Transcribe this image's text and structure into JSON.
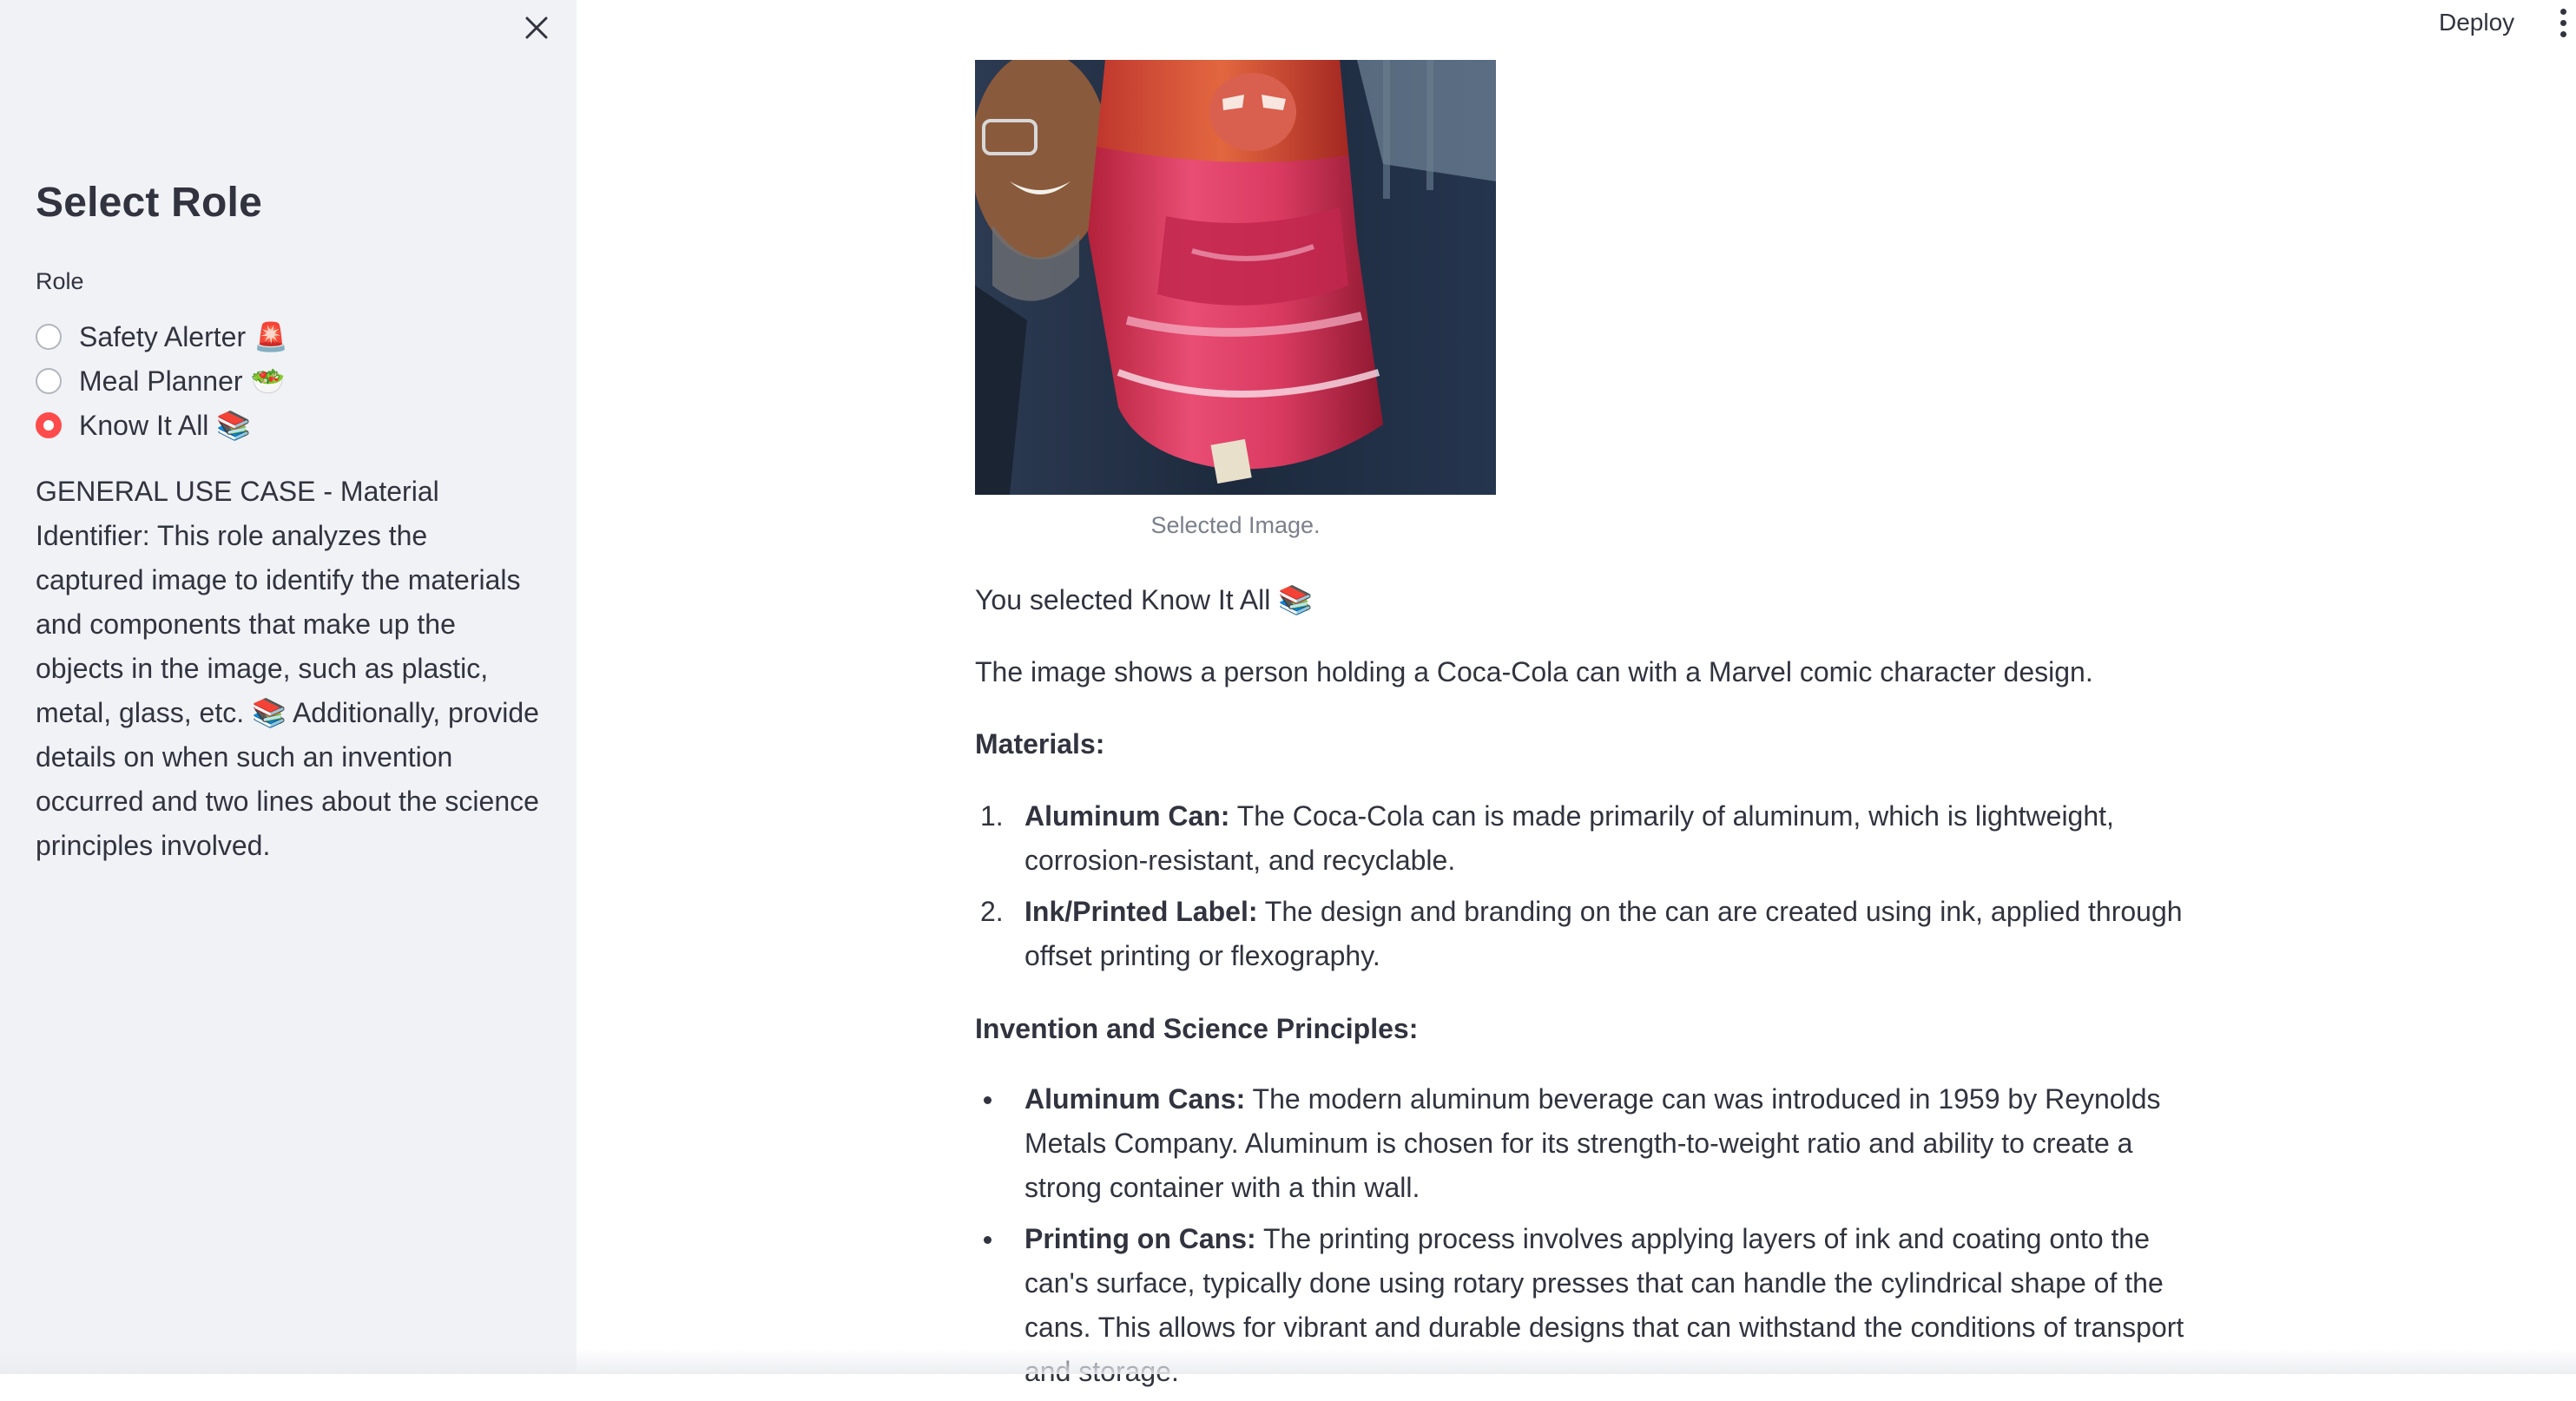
{
  "sidebar": {
    "title": "Select Role",
    "role_label": "Role",
    "options": [
      {
        "label": "Safety Alerter 🚨",
        "selected": false
      },
      {
        "label": "Meal Planner 🥗",
        "selected": false
      },
      {
        "label": "Know It All 📚",
        "selected": true
      }
    ],
    "description": "GENERAL USE CASE - Material Identifier: This role analyzes the captured image to identify the materials and components that make up the objects in the image, such as plastic, metal, glass, etc. 📚 Additionally, provide details on when such an invention occurred and two lines about the science principles involved."
  },
  "header": {
    "deploy_label": "Deploy",
    "menu_icon": "more-vertical-icon"
  },
  "main": {
    "image_caption": "Selected Image.",
    "selected_text": "You selected Know It All 📚",
    "summary": "The image shows a person holding a Coca-Cola can with a Marvel comic character design.",
    "materials_heading": "Materials:",
    "materials": [
      {
        "marker": "1.",
        "title": "Aluminum Can:",
        "text": " The Coca-Cola can is made primarily of aluminum, which is lightweight, corrosion-resistant, and recyclable."
      },
      {
        "marker": "2.",
        "title": "Ink/Printed Label:",
        "text": " The design and branding on the can are created using ink, applied through offset printing or flexography."
      }
    ],
    "invention_heading": "Invention and Science Principles:",
    "invention": [
      {
        "title": "Aluminum Cans:",
        "text": " The modern aluminum beverage can was introduced in 1959 by Reynolds Metals Company. Aluminum is chosen for its strength-to-weight ratio and ability to create a strong container with a thin wall."
      },
      {
        "title": "Printing on Cans:",
        "text": " The printing process involves applying layers of ink and coating onto the can's surface, typically done using rotary presses that can handle the cylindrical shape of the cans. This allows for vibrant and durable designs that can withstand the conditions of transport and storage."
      }
    ]
  },
  "colors": {
    "accent": "#ff4b4b",
    "sidebar_bg": "#f0f2f6",
    "text": "#31333f",
    "caption": "#7b7f8c"
  }
}
